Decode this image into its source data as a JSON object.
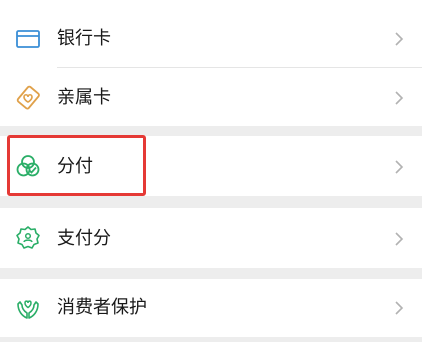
{
  "colors": {
    "background": "#ededed",
    "row": "#ffffff",
    "text": "#191919",
    "chevron": "#b2b2b2",
    "highlight": "#e53935",
    "bank_icon": "#3a8ed6",
    "family_icon": "#e0a14a",
    "green_icon": "#2aae67"
  },
  "menu": [
    {
      "label": "银行卡",
      "icon": "bank-card-icon"
    },
    {
      "label": "亲属卡",
      "icon": "family-card-icon"
    },
    {
      "label": "分付",
      "icon": "fenfu-icon"
    },
    {
      "label": "支付分",
      "icon": "payscore-icon"
    },
    {
      "label": "消费者保护",
      "icon": "consumer-protection-icon"
    }
  ]
}
